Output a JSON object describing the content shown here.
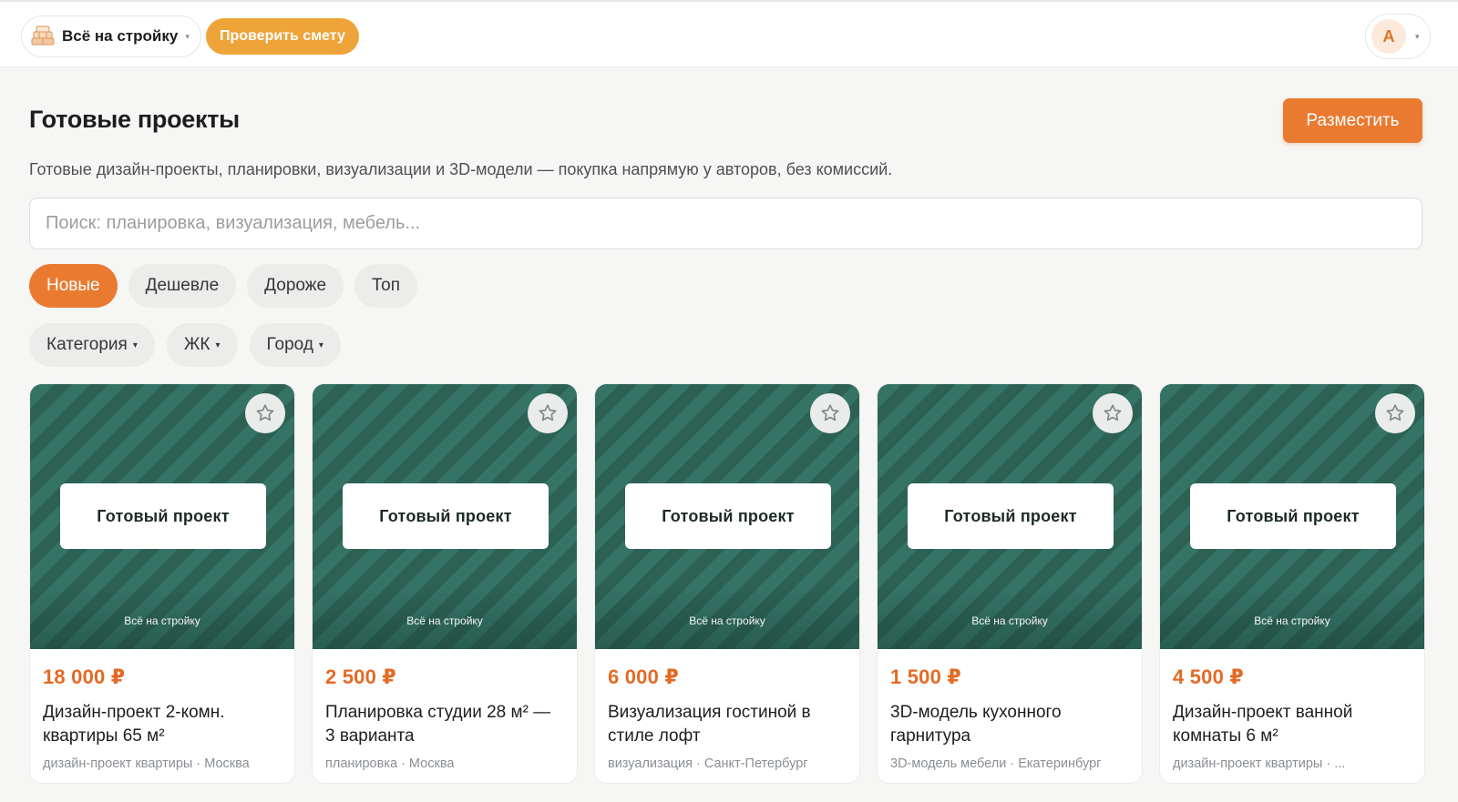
{
  "header": {
    "brand_name": "Всё на стройку",
    "brand_caret": "▾",
    "check_button": "Проверить смету",
    "user_initial": "А",
    "user_caret": "▾"
  },
  "page": {
    "title": "Готовые проекты",
    "post_button": "Разместить",
    "subtitle": "Готовые дизайн-проекты, планировки, визуализации и 3D-модели — покупка напрямую у авторов, без комиссий."
  },
  "search": {
    "placeholder": "Поиск: планировка, визуализация, мебель...",
    "value": ""
  },
  "sort": {
    "chips": [
      "Новые",
      "Дешевле",
      "Дороже",
      "Топ"
    ],
    "active": "Новые"
  },
  "filters": {
    "items": [
      "Категория",
      "ЖК",
      "Город"
    ],
    "caret": "▾"
  },
  "colors": {
    "accent": "#ea7a30",
    "check_button": "#efa43a",
    "price": "#e46a24",
    "thumb_green": "#2f6a5d"
  },
  "cards": [
    {
      "badge": "Готовый проект",
      "watermark": "Всё на стройку",
      "price": "18 000 ₽",
      "title": "Дизайн-проект 2-комн. квартиры 65 м²",
      "meta": "дизайн-проект квартиры · Москва",
      "fav_icon": "star-outline-icon"
    },
    {
      "badge": "Готовый проект",
      "watermark": "Всё на стройку",
      "price": "2 500 ₽",
      "title": "Планировка студии 28 м² — 3 варианта",
      "meta": "планировка · Москва",
      "fav_icon": "star-outline-icon"
    },
    {
      "badge": "Готовый проект",
      "watermark": "Всё на стройку",
      "price": "6 000 ₽",
      "title": "Визуализация гостиной в стиле лофт",
      "meta": "визуализация · Санкт-Петербург",
      "fav_icon": "star-outline-icon"
    },
    {
      "badge": "Готовый проект",
      "watermark": "Всё на стройку",
      "price": "1 500 ₽",
      "title": "3D-модель кухонного гарнитура",
      "meta": "3D-модель мебели · Екатеринбург",
      "fav_icon": "star-outline-icon"
    },
    {
      "badge": "Готовый проект",
      "watermark": "Всё на стройку",
      "price": "4 500 ₽",
      "title": "Дизайн-проект ванной комнаты 6 м²",
      "meta": "дизайн-проект квартиры · ...",
      "fav_icon": "star-outline-icon"
    }
  ]
}
